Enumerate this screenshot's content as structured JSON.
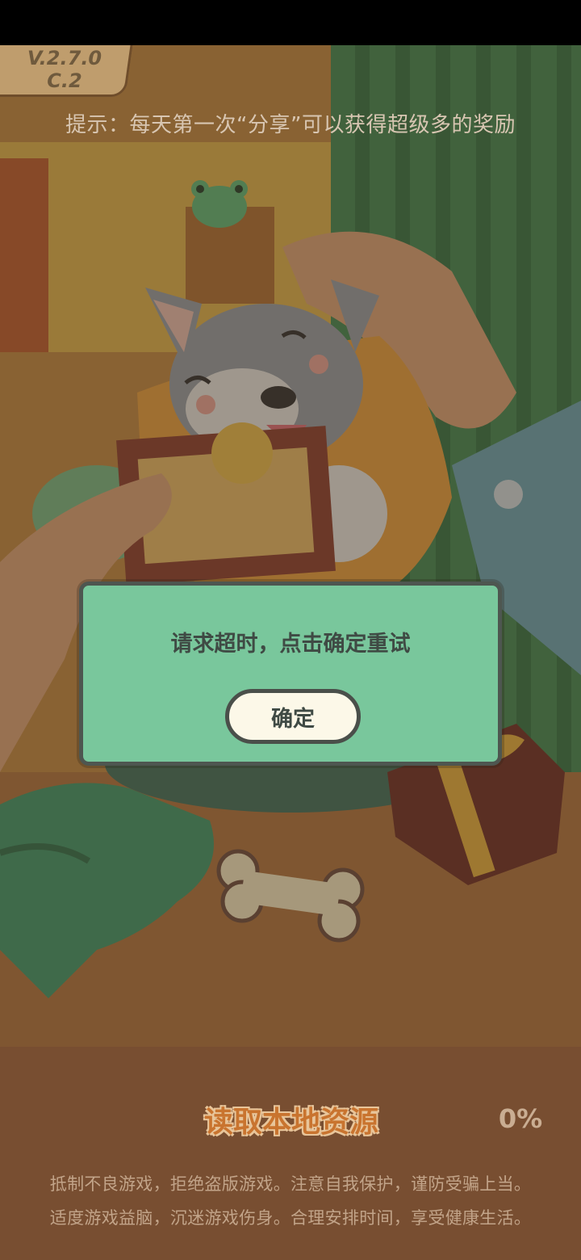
{
  "header": {
    "version": "V.2.7.0\nC.2",
    "tip": "提示：每天第一次“分享”可以获得超级多的奖励"
  },
  "dialog": {
    "message": "请求超时，点击确定重试",
    "confirm_label": "确定"
  },
  "loading": {
    "label": "读取本地资源",
    "percent": "0%"
  },
  "notice": {
    "line1": "抵制不良游戏，拒绝盗版游戏。注意自我保护，谨防受骗上当。",
    "line2": "适度游戏益脑，沉迷游戏伤身。合理安排时间，享受健康生活。"
  },
  "colors": {
    "dialog_bg": "#79c79c",
    "dialog_border": "#4e5650",
    "button_bg": "#fcf8e8",
    "loading_label": "#c9742f"
  },
  "icons": {
    "bone": "bone-icon",
    "gift": "gift-box-icon",
    "frog": "frog-toy-icon"
  }
}
